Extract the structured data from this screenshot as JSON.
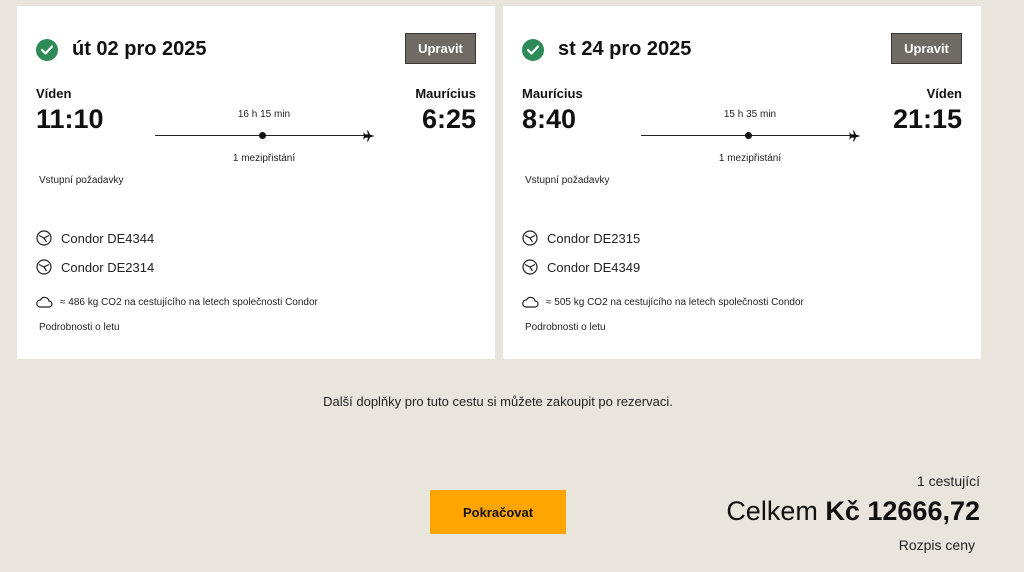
{
  "colors": {
    "background": "#e9e5dc",
    "card": "#ffffff",
    "check": "#2e8b57",
    "edit_button": "#6f6a63",
    "continue_button": "#ffa400"
  },
  "legs": [
    {
      "date": "út 02 pro 2025",
      "edit_label": "Upravit",
      "origin_city": "Víden",
      "origin_time": "11:10",
      "dest_city": "Maurícius",
      "dest_time": "6:25",
      "duration": "16 h 15 min",
      "stops": "1 mezipřistání",
      "entry_requirements": "Vstupní požadavky",
      "flights": [
        "Condor DE4344",
        "Condor DE2314"
      ],
      "co2": "≈ 486 kg CO2 na cestujícího na letech společnosti Condor",
      "details_link": "Podrobnosti o letu"
    },
    {
      "date": "st 24 pro 2025",
      "edit_label": "Upravit",
      "origin_city": "Maurícius",
      "origin_time": "8:40",
      "dest_city": "Víden",
      "dest_time": "21:15",
      "duration": "15 h 35 min",
      "stops": "1 mezipřistání",
      "entry_requirements": "Vstupní požadavky",
      "flights": [
        "Condor DE2315",
        "Condor DE4349"
      ],
      "co2": "≈ 505 kg CO2 na cestujícího na letech společnosti Condor",
      "details_link": "Podrobnosti o letu"
    }
  ],
  "extras_note": "Další doplňky pro tuto cestu si můžete zakoupit po rezervaci.",
  "summary": {
    "passengers": "1 cestující",
    "total_label": "Celkem",
    "total_amount": "Kč 12666,72",
    "breakdown_link": "Rozpis ceny",
    "continue_label": "Pokračovat"
  },
  "icons": {
    "check": "check-circle-icon",
    "plane": "airplane-icon",
    "airline": "condor-logo-icon",
    "co2": "cloud-icon"
  }
}
